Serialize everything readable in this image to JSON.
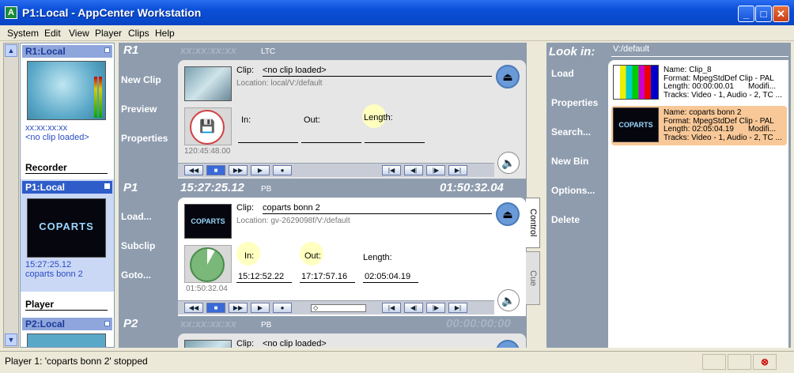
{
  "window": {
    "title": "P1:Local - AppCenter Workstation",
    "icon_letter": "A"
  },
  "menu": [
    "System",
    "Edit",
    "View",
    "Player",
    "Clips",
    "Help"
  ],
  "sources": {
    "r1": {
      "name": "R1:Local",
      "timecode": "xx:xx:xx:xx",
      "clip": "<no clip loaded>",
      "section": "Recorder"
    },
    "p1": {
      "name": "P1:Local",
      "timecode": "15:27:25.12",
      "clip": "coparts bonn 2",
      "section": "Player"
    },
    "p2": {
      "name": "P2:Local"
    }
  },
  "r1": {
    "name": "R1",
    "timecode": "xx:xx:xx:xx",
    "tc_type": "LTC",
    "side_buttons": [
      "New Clip",
      "Preview",
      "Properties"
    ],
    "clip_label": "Clip:",
    "clip_value": "<no clip loaded>",
    "location": "Location:  local/V:/default",
    "in_label": "In:",
    "out_label": "Out:",
    "length_label": "Length:",
    "record_time": "120:45:48.00"
  },
  "p1": {
    "name": "P1",
    "timecode": "15:27:25.12",
    "tc_type": "PB",
    "remaining": "01:50:32.04",
    "side_buttons": [
      "Load...",
      "Subclip",
      "Goto..."
    ],
    "clip_label": "Clip:",
    "clip_value": "coparts bonn 2",
    "location": "Location:  gv-2629098f/V:/default",
    "in_label": "In:",
    "in_value": "15:12:52.22",
    "out_label": "Out:",
    "out_value": "17:17:57.16",
    "length_label": "Length:",
    "length_value": "02:05:04.19",
    "dial_time": "01:50:32.04"
  },
  "p2": {
    "name": "P2",
    "timecode": "xx:xx:xx:xx",
    "tc_type": "PB",
    "remaining": "00:00:00:00",
    "clip_label": "Clip:",
    "clip_value": "<no clip loaded>"
  },
  "tabs": {
    "control": "Control",
    "cue": "Cue"
  },
  "bin": {
    "look_in": "Look in:",
    "path": "V:/default",
    "buttons": [
      "Load",
      "Properties",
      "Search...",
      "New Bin",
      "Options...",
      "Delete"
    ],
    "items": [
      {
        "name": "Name: Clip_8",
        "format": "Format: MpegStdDef Clip - PAL",
        "length": "Length: 00:00:00.01",
        "modified": "Modifi...",
        "tracks": "Tracks: Video - 1, Audio - 2, TC ..."
      },
      {
        "name": "Name: coparts bonn 2",
        "format": "Format: MpegStdDef Clip - PAL",
        "length": "Length: 02:05:04.19",
        "modified": "Modifi...",
        "tracks": "Tracks: Video - 1, Audio - 2, TC ..."
      }
    ]
  },
  "status": {
    "text": "Player 1: 'coparts bonn 2' stopped"
  },
  "colors": {
    "accent": "#0a4fd8",
    "selected_bin_item": "#f8c898",
    "panel_bg": "#8e9cae"
  }
}
